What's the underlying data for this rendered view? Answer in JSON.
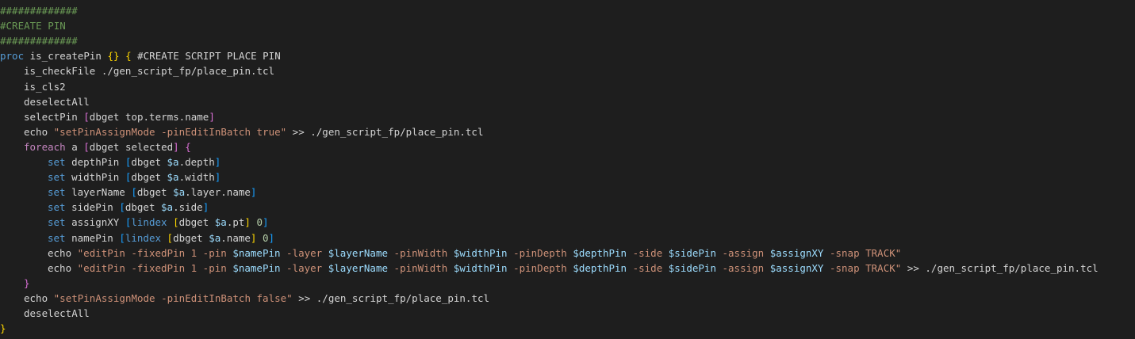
{
  "editor": {
    "lines": [
      {
        "indent": 0,
        "tokens": [
          {
            "t": "#############",
            "c": "comment"
          }
        ]
      },
      {
        "indent": 0,
        "tokens": [
          {
            "t": "#CREATE PIN",
            "c": "comment"
          }
        ]
      },
      {
        "indent": 0,
        "tokens": [
          {
            "t": "#############",
            "c": "comment"
          }
        ]
      },
      {
        "indent": 0,
        "tokens": [
          {
            "t": "proc",
            "c": "keyword"
          },
          {
            "t": " is_createPin ",
            "c": "plain"
          },
          {
            "t": "{}",
            "c": "b1"
          },
          {
            "t": " ",
            "c": "plain"
          },
          {
            "t": "{",
            "c": "b1"
          },
          {
            "t": " #CREATE SCRIPT PLACE PIN",
            "c": "plain"
          }
        ]
      },
      {
        "indent": 1,
        "tokens": [
          {
            "t": "is_checkFile ./gen_script_fp/place_pin.tcl",
            "c": "plain"
          }
        ]
      },
      {
        "indent": 1,
        "tokens": [
          {
            "t": "is_cls2",
            "c": "plain"
          }
        ]
      },
      {
        "indent": 1,
        "tokens": [
          {
            "t": "deselectAll",
            "c": "plain"
          }
        ]
      },
      {
        "indent": 1,
        "tokens": [
          {
            "t": "selectPin ",
            "c": "plain"
          },
          {
            "t": "[",
            "c": "b2"
          },
          {
            "t": "dbget top.terms.name",
            "c": "plain"
          },
          {
            "t": "]",
            "c": "b2"
          }
        ]
      },
      {
        "indent": 1,
        "tokens": [
          {
            "t": "echo ",
            "c": "plain"
          },
          {
            "t": "\"setPinAssignMode -pinEditInBatch true\"",
            "c": "string"
          },
          {
            "t": " >> ./gen_script_fp/place_pin.tcl",
            "c": "plain"
          }
        ]
      },
      {
        "indent": 1,
        "tokens": [
          {
            "t": "foreach",
            "c": "control"
          },
          {
            "t": " a ",
            "c": "plain"
          },
          {
            "t": "[",
            "c": "b2"
          },
          {
            "t": "dbget selected",
            "c": "plain"
          },
          {
            "t": "]",
            "c": "b2"
          },
          {
            "t": " ",
            "c": "plain"
          },
          {
            "t": "{",
            "c": "b2"
          }
        ]
      },
      {
        "indent": 2,
        "tokens": [
          {
            "t": "set",
            "c": "keyword"
          },
          {
            "t": " depthPin ",
            "c": "plain"
          },
          {
            "t": "[",
            "c": "b3"
          },
          {
            "t": "dbget ",
            "c": "plain"
          },
          {
            "t": "$a",
            "c": "var"
          },
          {
            "t": ".depth",
            "c": "plain"
          },
          {
            "t": "]",
            "c": "b3"
          }
        ]
      },
      {
        "indent": 2,
        "tokens": [
          {
            "t": "set",
            "c": "keyword"
          },
          {
            "t": " widthPin ",
            "c": "plain"
          },
          {
            "t": "[",
            "c": "b3"
          },
          {
            "t": "dbget ",
            "c": "plain"
          },
          {
            "t": "$a",
            "c": "var"
          },
          {
            "t": ".width",
            "c": "plain"
          },
          {
            "t": "]",
            "c": "b3"
          }
        ]
      },
      {
        "indent": 2,
        "tokens": [
          {
            "t": "set",
            "c": "keyword"
          },
          {
            "t": " layerName ",
            "c": "plain"
          },
          {
            "t": "[",
            "c": "b3"
          },
          {
            "t": "dbget ",
            "c": "plain"
          },
          {
            "t": "$a",
            "c": "var"
          },
          {
            "t": ".layer.name",
            "c": "plain"
          },
          {
            "t": "]",
            "c": "b3"
          }
        ]
      },
      {
        "indent": 2,
        "tokens": [
          {
            "t": "set",
            "c": "keyword"
          },
          {
            "t": " sidePin ",
            "c": "plain"
          },
          {
            "t": "[",
            "c": "b3"
          },
          {
            "t": "dbget ",
            "c": "plain"
          },
          {
            "t": "$a",
            "c": "var"
          },
          {
            "t": ".side",
            "c": "plain"
          },
          {
            "t": "]",
            "c": "b3"
          }
        ]
      },
      {
        "indent": 2,
        "tokens": [
          {
            "t": "set",
            "c": "keyword"
          },
          {
            "t": " assignXY ",
            "c": "plain"
          },
          {
            "t": "[",
            "c": "b3"
          },
          {
            "t": "lindex ",
            "c": "keyword"
          },
          {
            "t": "[",
            "c": "b1"
          },
          {
            "t": "dbget ",
            "c": "plain"
          },
          {
            "t": "$a",
            "c": "var"
          },
          {
            "t": ".pt",
            "c": "plain"
          },
          {
            "t": "]",
            "c": "b1"
          },
          {
            "t": " ",
            "c": "plain"
          },
          {
            "t": "0",
            "c": "num"
          },
          {
            "t": "]",
            "c": "b3"
          }
        ]
      },
      {
        "indent": 2,
        "tokens": [
          {
            "t": "set",
            "c": "keyword"
          },
          {
            "t": " namePin ",
            "c": "plain"
          },
          {
            "t": "[",
            "c": "b3"
          },
          {
            "t": "lindex ",
            "c": "keyword"
          },
          {
            "t": "[",
            "c": "b1"
          },
          {
            "t": "dbget ",
            "c": "plain"
          },
          {
            "t": "$a",
            "c": "var"
          },
          {
            "t": ".name",
            "c": "plain"
          },
          {
            "t": "]",
            "c": "b1"
          },
          {
            "t": " ",
            "c": "plain"
          },
          {
            "t": "0",
            "c": "num"
          },
          {
            "t": "]",
            "c": "b3"
          }
        ]
      },
      {
        "indent": 2,
        "tokens": [
          {
            "t": "echo ",
            "c": "plain"
          },
          {
            "t": "\"editPin -fixedPin 1 -pin ",
            "c": "string"
          },
          {
            "t": "$namePin",
            "c": "var"
          },
          {
            "t": " -layer ",
            "c": "string"
          },
          {
            "t": "$layerName",
            "c": "var"
          },
          {
            "t": " -pinWidth ",
            "c": "string"
          },
          {
            "t": "$widthPin",
            "c": "var"
          },
          {
            "t": " -pinDepth ",
            "c": "string"
          },
          {
            "t": "$depthPin",
            "c": "var"
          },
          {
            "t": " -side ",
            "c": "string"
          },
          {
            "t": "$sidePin",
            "c": "var"
          },
          {
            "t": " -assign ",
            "c": "string"
          },
          {
            "t": "$assignXY",
            "c": "var"
          },
          {
            "t": " -snap TRACK\"",
            "c": "string"
          }
        ]
      },
      {
        "indent": 2,
        "tokens": [
          {
            "t": "echo ",
            "c": "plain"
          },
          {
            "t": "\"editPin -fixedPin 1 -pin ",
            "c": "string"
          },
          {
            "t": "$namePin",
            "c": "var"
          },
          {
            "t": " -layer ",
            "c": "string"
          },
          {
            "t": "$layerName",
            "c": "var"
          },
          {
            "t": " -pinWidth ",
            "c": "string"
          },
          {
            "t": "$widthPin",
            "c": "var"
          },
          {
            "t": " -pinDepth ",
            "c": "string"
          },
          {
            "t": "$depthPin",
            "c": "var"
          },
          {
            "t": " -side ",
            "c": "string"
          },
          {
            "t": "$sidePin",
            "c": "var"
          },
          {
            "t": " -assign ",
            "c": "string"
          },
          {
            "t": "$assignXY",
            "c": "var"
          },
          {
            "t": " -snap TRACK\"",
            "c": "string"
          },
          {
            "t": " >> ./gen_script_fp/place_pin.tcl",
            "c": "plain"
          }
        ]
      },
      {
        "indent": 1,
        "tokens": [
          {
            "t": "}",
            "c": "b2"
          }
        ]
      },
      {
        "indent": 1,
        "tokens": [
          {
            "t": "echo ",
            "c": "plain"
          },
          {
            "t": "\"setPinAssignMode -pinEditInBatch false\"",
            "c": "string"
          },
          {
            "t": " >> ./gen_script_fp/place_pin.tcl",
            "c": "plain"
          }
        ]
      },
      {
        "indent": 1,
        "tokens": [
          {
            "t": "deselectAll",
            "c": "plain"
          }
        ]
      },
      {
        "indent": 0,
        "tokens": [
          {
            "t": "}",
            "c": "b1"
          }
        ]
      }
    ]
  }
}
